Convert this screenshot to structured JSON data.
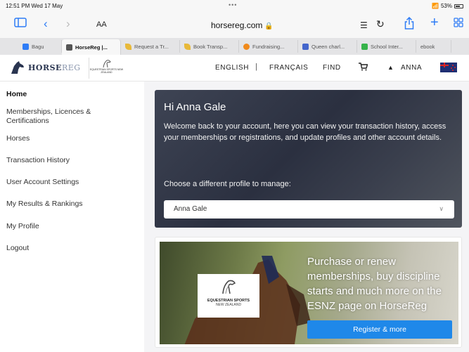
{
  "status_bar": {
    "time": "12:51 PM  Wed 17 May",
    "dots": "•••",
    "battery": "53%"
  },
  "browser": {
    "text_size": "AA",
    "url": "horsereg.com",
    "tabs": [
      {
        "label": "Bagu",
        "favicon_color": "#2e7cf6"
      },
      {
        "label": "HorseReg |...",
        "favicon_color": "#555555"
      },
      {
        "label": "Request a Tr...",
        "favicon_color": "#e8b93a"
      },
      {
        "label": "Book Transp...",
        "favicon_color": "#e8b93a"
      },
      {
        "label": "Fundraising...",
        "favicon_color": "#f08a1c"
      },
      {
        "label": "Queen charl...",
        "favicon_color": "#4466cc"
      },
      {
        "label": "School Inter...",
        "favicon_color": "#36b34a"
      },
      {
        "label": "ebook",
        "favicon_color": "#cccccc"
      }
    ]
  },
  "site_header": {
    "brand_main": "HORSE",
    "brand_suffix": "REG",
    "esnz_mini": "EQUESTRIAN SPORTS NEW ZEALAND",
    "nav": {
      "english": "ENGLISH",
      "sep": "|",
      "francais": "FRANÇAIS",
      "find": "FIND",
      "user": "ANNA"
    }
  },
  "sidebar": {
    "items": [
      {
        "label": "Home",
        "active": true
      },
      {
        "label": "Memberships, Licences & Certifications"
      },
      {
        "label": "Horses"
      },
      {
        "label": "Transaction History"
      },
      {
        "label": "User Account Settings"
      },
      {
        "label": "My Results & Rankings"
      },
      {
        "label": "My Profile"
      },
      {
        "label": "Logout"
      }
    ]
  },
  "welcome": {
    "greeting": "Hi Anna Gale",
    "description": "Welcome back to your account, here you can view your transaction history, access your memberships or registrations, and update profiles and other account details.",
    "choose_label": "Choose a different profile to manage:",
    "selected_profile": "Anna Gale"
  },
  "promo": {
    "org_name": "EQUESTRIAN SPORTS",
    "org_country": "NEW ZEALAND",
    "text": "Purchase or renew memberships, buy discipline starts and much more on the ESNZ page on HorseReg",
    "button": "Register & more"
  },
  "colors": {
    "accent": "#1f88e9",
    "browser_blue": "#2e7cf6",
    "hero_dark": "#2b3040"
  }
}
